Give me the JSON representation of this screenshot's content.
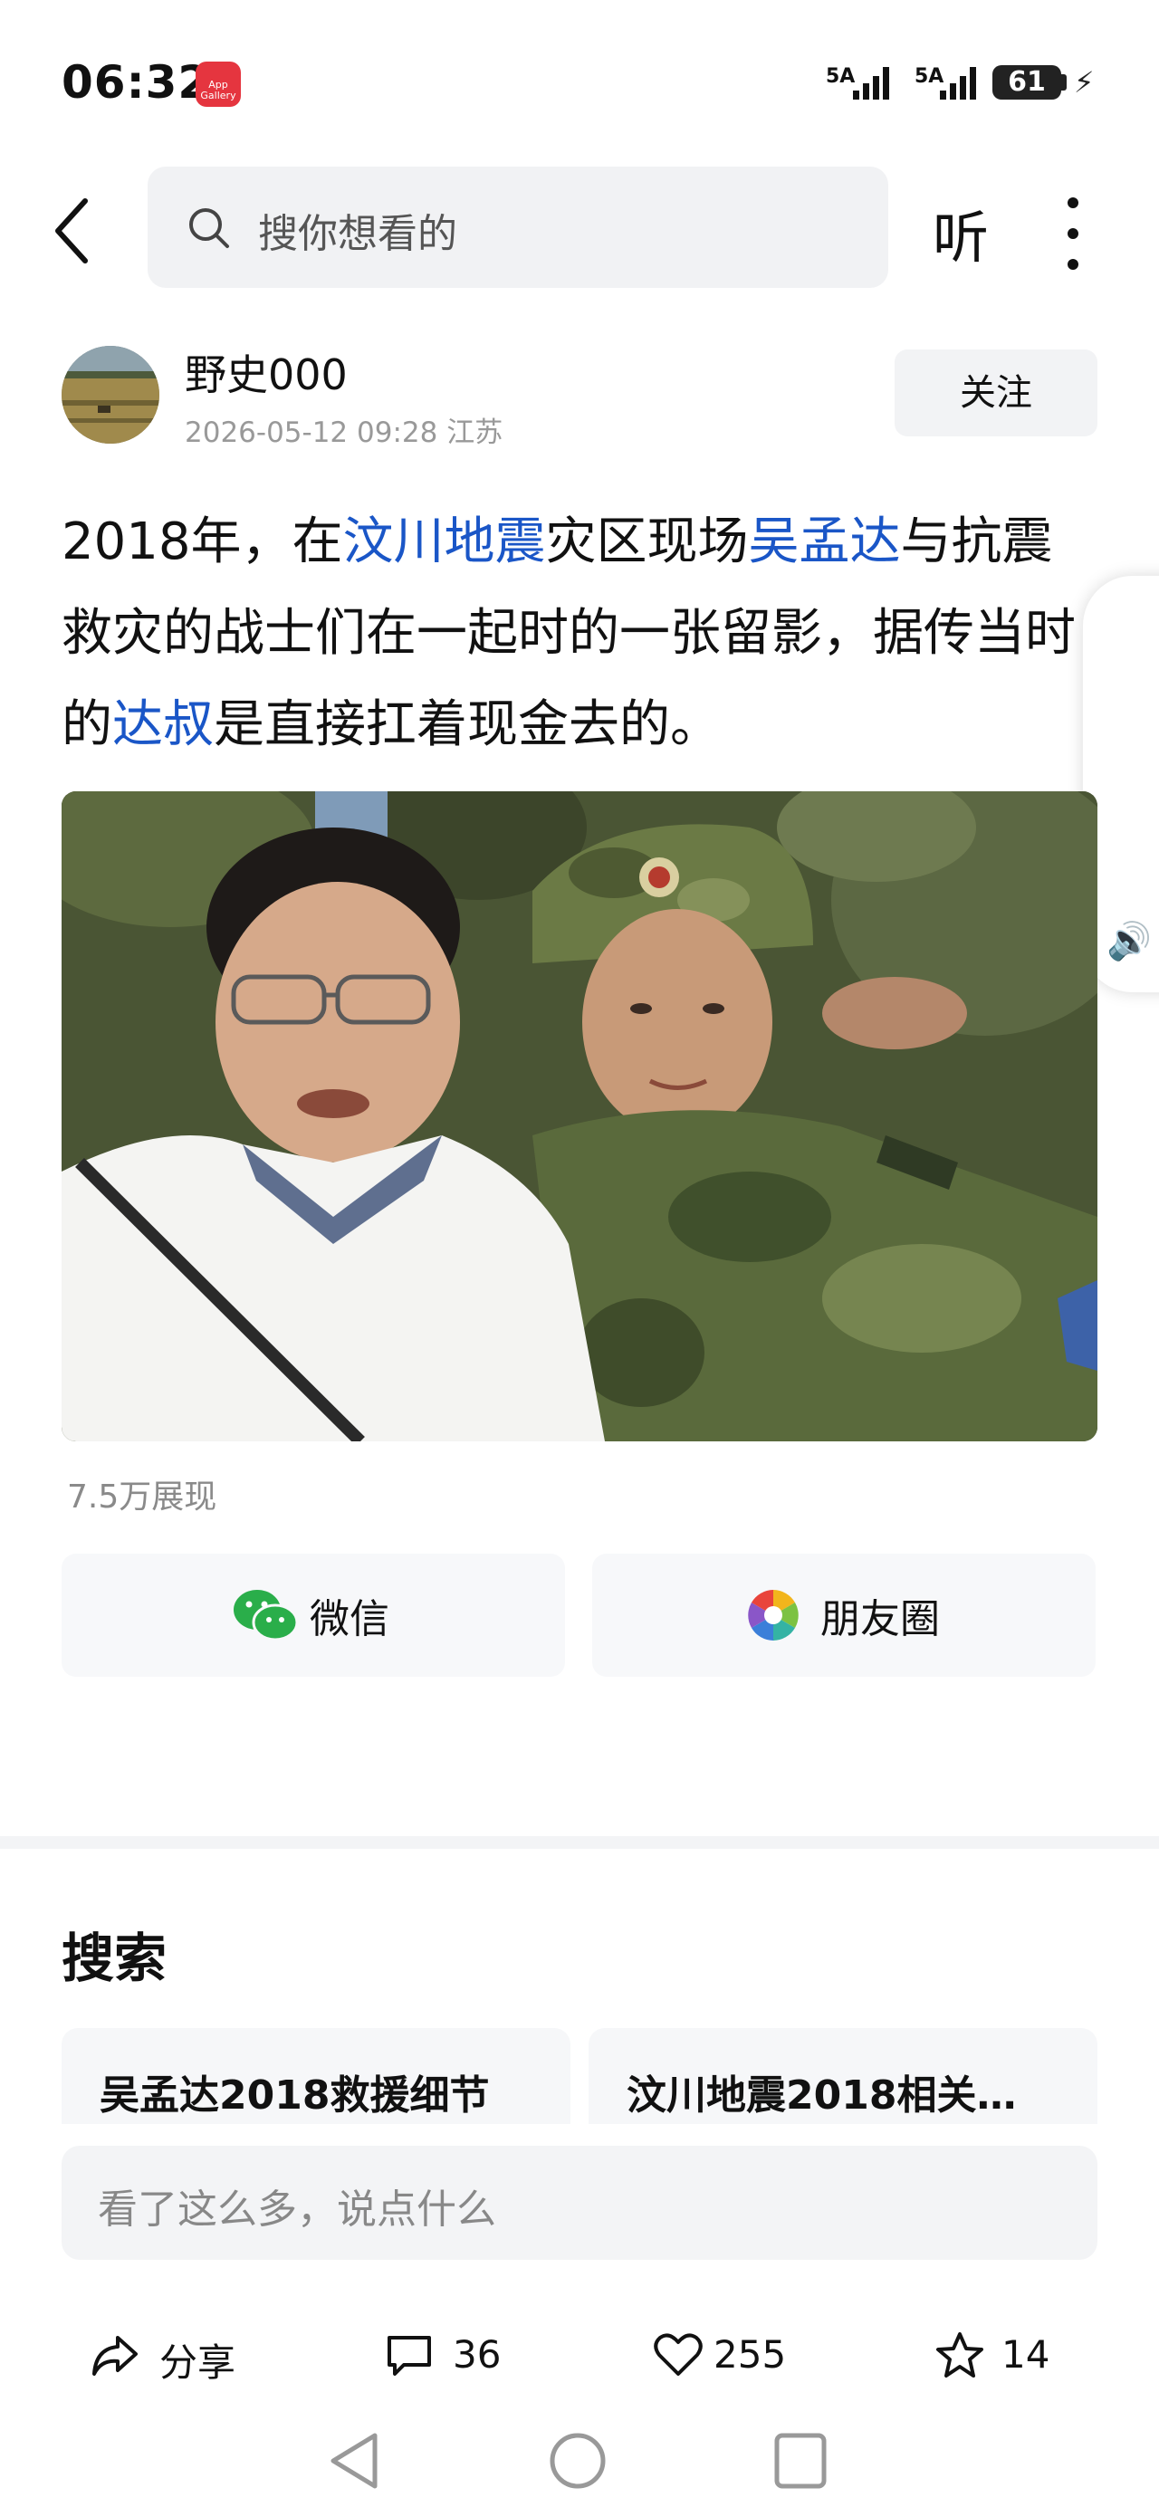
{
  "status_bar": {
    "time": "06:32",
    "app_badge": "App Gallery",
    "signal1_label": "5A",
    "signal2_label": "5A",
    "battery": "61"
  },
  "top_bar": {
    "search_placeholder": "搜你想看的",
    "listen_label": "听"
  },
  "author": {
    "name": "野史000",
    "meta": "2026-05-12 09:28 江苏",
    "follow_label": "关注"
  },
  "article": {
    "seg1": "2018年，在",
    "link1": "汶川地震",
    "seg2": "灾区现场",
    "link2": "吴孟达",
    "seg3": "与抗震救灾的战士们在一起时的一张留影，据传当时的",
    "link3": "达叔",
    "seg4": "是直接扛着现金去的。"
  },
  "stats": {
    "views": "7.5万展现"
  },
  "share": {
    "wechat_label": "微信",
    "moments_label": "朋友圈"
  },
  "search_section": {
    "title": "搜索",
    "suggestions": [
      "吴孟达2018救援细节",
      "汶川地震2018相关…"
    ]
  },
  "comment": {
    "placeholder": "看了这么多，说点什么"
  },
  "actions": {
    "share_label": "分享",
    "comments_count": "36",
    "likes_count": "255",
    "favorites_count": "14"
  },
  "colors": {
    "link": "#1a56c7",
    "badge": "#e5353f",
    "wechat_green": "#2aae4a"
  }
}
